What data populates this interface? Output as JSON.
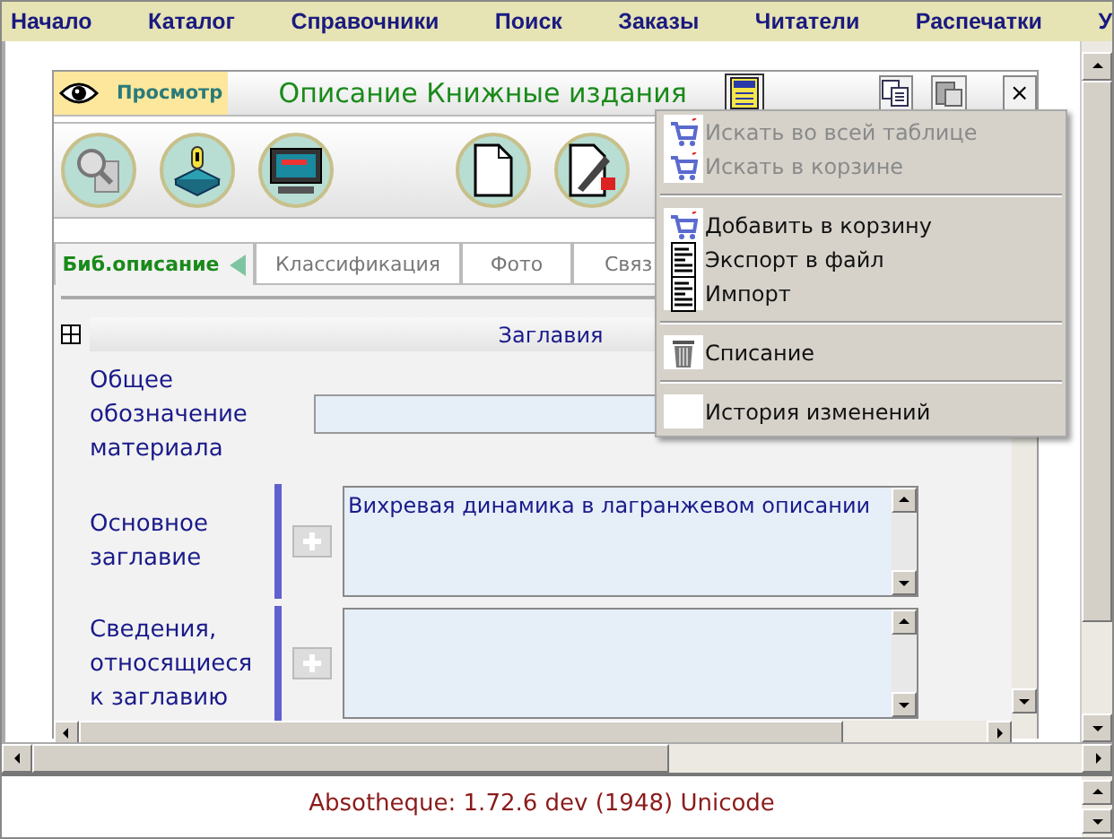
{
  "menu_bar": [
    "Начало",
    "Каталог",
    "Справочники",
    "Поиск",
    "Заказы",
    "Читатели",
    "Распечатки",
    "У"
  ],
  "panel": {
    "mode_label": "Просмотр",
    "title": "Описание Книжные издания",
    "close": "×"
  },
  "tabs": [
    {
      "label": "Биб.описание",
      "selected": true
    },
    {
      "label": "Классификация",
      "selected": false
    },
    {
      "label": "Фото",
      "selected": false
    },
    {
      "label": "Связ",
      "selected": false
    }
  ],
  "section": {
    "title": "Заглавия"
  },
  "fields": [
    {
      "kind": "single",
      "label": "Общее обозначение материала"
    },
    {
      "kind": "multiline",
      "label": "Основное заглавие",
      "value": "Вихревая динамика в лагранжевом описании"
    },
    {
      "kind": "multiline",
      "label": "Сведения, относящиеся к заглавию"
    }
  ],
  "context_menu": [
    [
      {
        "kind": "cart",
        "label": "Искать во всей таблице",
        "disabled": true
      },
      {
        "kind": "cart",
        "label": "Искать в корзине",
        "disabled": true
      }
    ],
    [
      {
        "kind": "cart",
        "label": "Добавить в корзину",
        "disabled": false
      },
      {
        "kind": "document",
        "label": "Экспорт в файл",
        "disabled": false
      },
      {
        "kind": "document",
        "label": "Импорт",
        "disabled": false
      }
    ],
    [
      {
        "kind": "trash",
        "label": "Списание",
        "disabled": false
      }
    ],
    [
      {
        "kind": "blank",
        "label": "История изменений",
        "disabled": false
      }
    ]
  ],
  "footer": "Absotheque: 1.72.6 dev (1948) Unicode"
}
